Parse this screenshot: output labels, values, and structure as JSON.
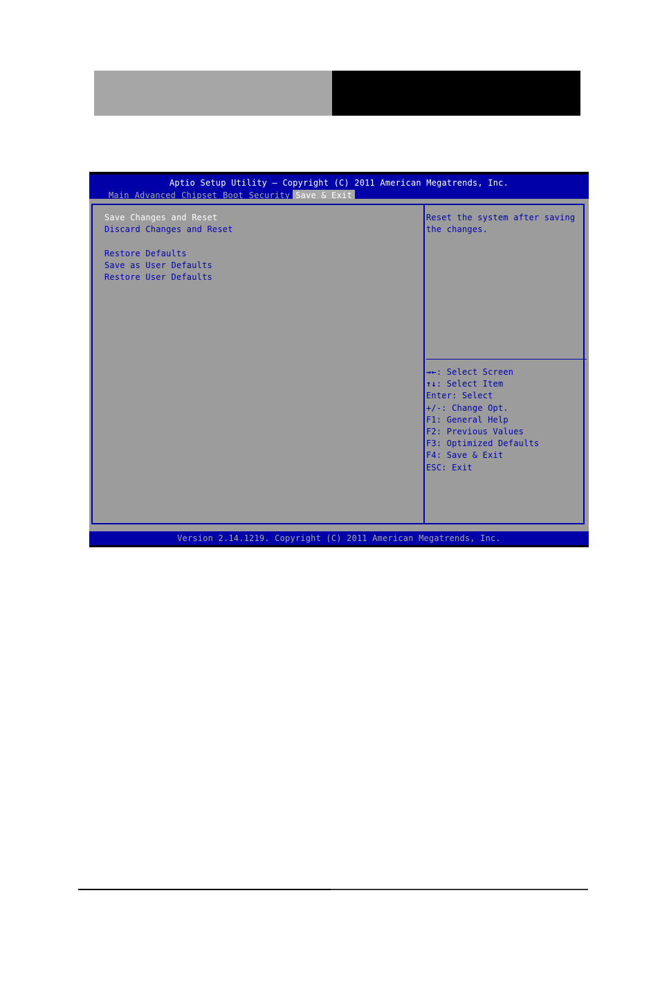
{
  "bios": {
    "title": "Aptio Setup Utility – Copyright (C) 2011 American Megatrends, Inc.",
    "tabs": [
      {
        "label": "Main"
      },
      {
        "label": "Advanced"
      },
      {
        "label": "Chipset"
      },
      {
        "label": "Boot"
      },
      {
        "label": "Security"
      },
      {
        "label": "Save & Exit",
        "active": true
      }
    ],
    "menu": {
      "items": [
        {
          "label": "Save Changes and Reset",
          "selected": true
        },
        {
          "label": "Discard Changes and Reset"
        },
        {
          "label": "Restore Defaults"
        },
        {
          "label": "Save as User Defaults"
        },
        {
          "label": "Restore User Defaults"
        }
      ]
    },
    "help": {
      "text": "Reset the system after saving the changes."
    },
    "keys": [
      {
        "key": "→←",
        "desc": ": Select Screen"
      },
      {
        "key": "↑↓",
        "desc": ": Select Item"
      },
      {
        "key": "Enter",
        "desc": ": Select"
      },
      {
        "key": "+/-",
        "desc": ": Change Opt."
      },
      {
        "key": "F1",
        "desc": ": General Help"
      },
      {
        "key": "F2",
        "desc": ": Previous Values"
      },
      {
        "key": "F3",
        "desc": ": Optimized Defaults"
      },
      {
        "key": "F4",
        "desc": ": Save & Exit"
      },
      {
        "key": "ESC",
        "desc": ": Exit"
      }
    ],
    "version": "Version 2.14.1219. Copyright (C) 2011 American Megatrends, Inc."
  },
  "colors": {
    "bios_blue": "#0000a8",
    "bios_gray": "#9c9c9c",
    "header_gray": "#a6a6a6",
    "header_black": "#000000"
  }
}
